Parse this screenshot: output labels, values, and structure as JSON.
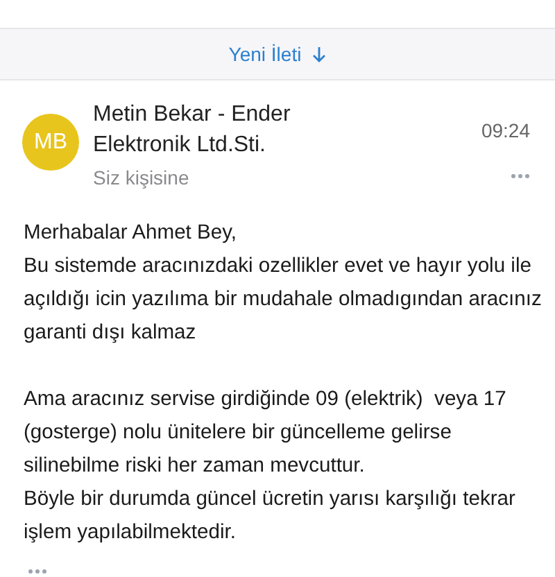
{
  "banner": {
    "label": "Yeni İleti"
  },
  "message": {
    "avatar_initials": "MB",
    "sender_lines": [
      "Metin Bekar - Ender",
      "Elektronik Ltd.Sti."
    ],
    "time": "09:24",
    "recipient": "Siz kişisine",
    "paragraphs": [
      [
        "Merhabalar Ahmet Bey,",
        "Bu sistemde aracınızdaki ozellikler evet ve hayır yolu ile",
        "açıldığı icin yazılıma bir mudahale olmadıgından aracınız",
        "garanti dışı kalmaz"
      ],
      [
        "Ama aracınız servise girdiğinde 09 (elektrik)  veya 17",
        "(gosterge) nolu ünitelere bir güncelleme gelirse",
        "silinebilme riski her zaman mevcuttur.",
        "Böyle bir durumda güncel ücretin yarısı karşılığı tekrar",
        "işlem yapılabilmektedir."
      ]
    ]
  }
}
